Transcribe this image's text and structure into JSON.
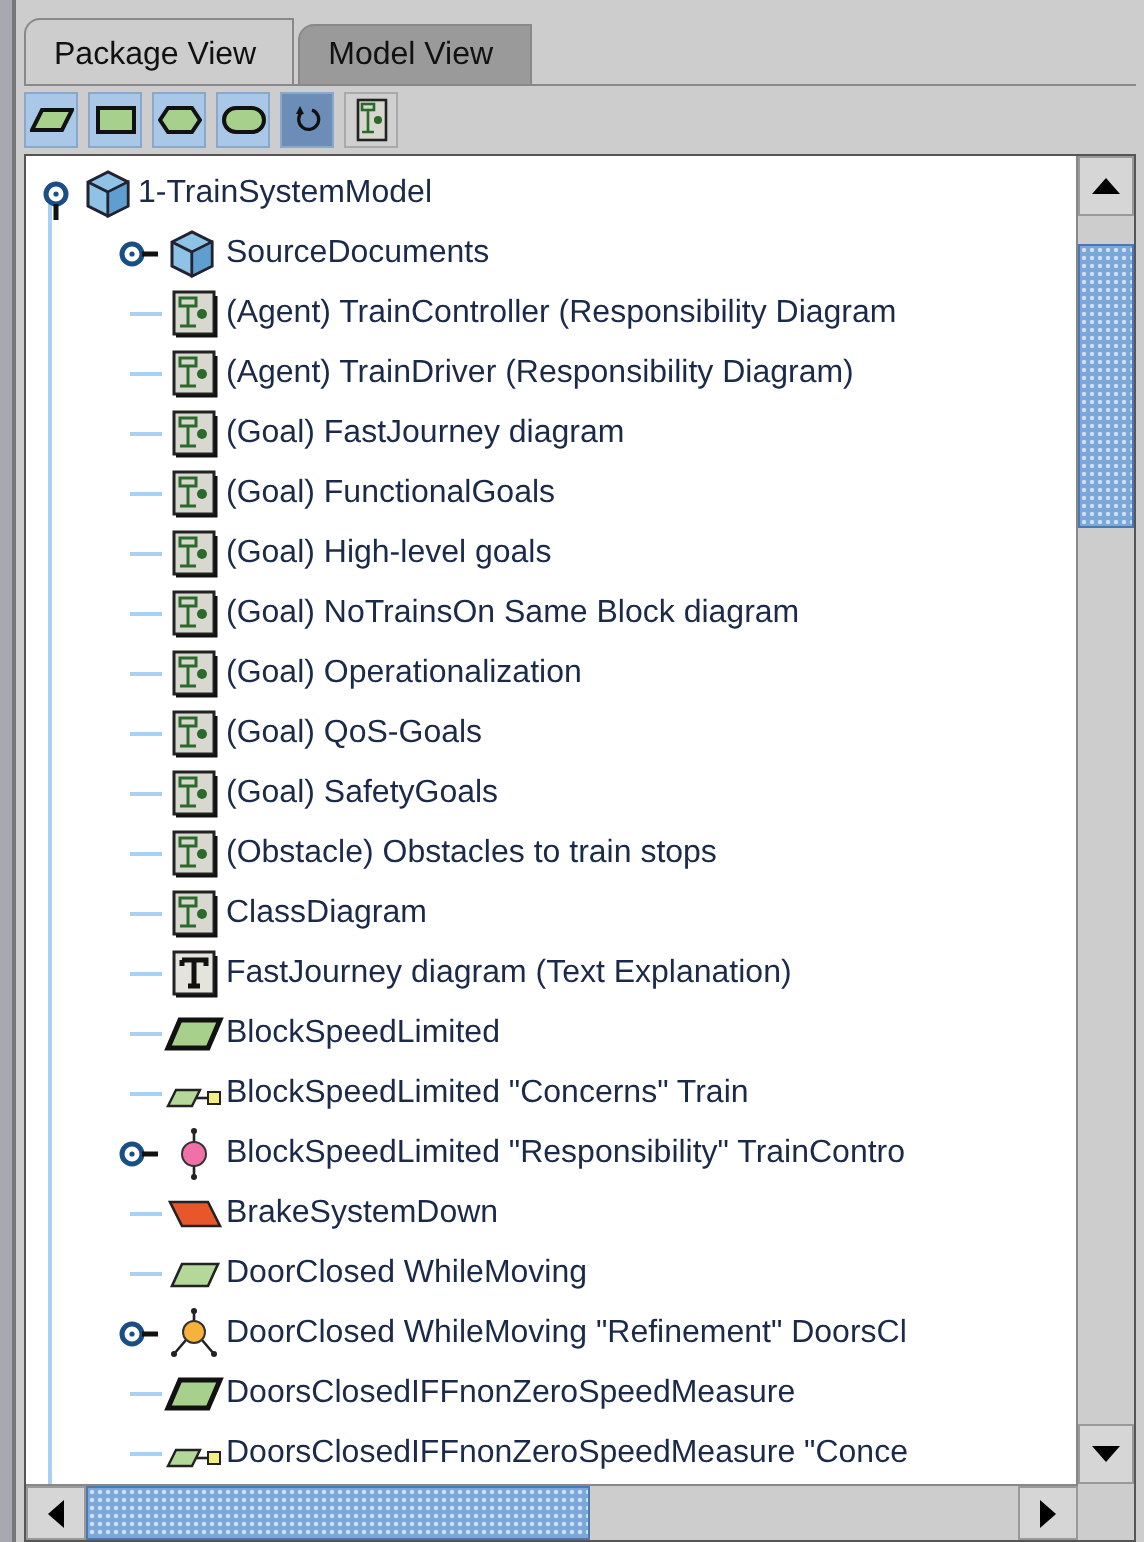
{
  "tabs": [
    {
      "label": "Package View",
      "selected": true
    },
    {
      "label": "Model View",
      "selected": false
    }
  ],
  "toolbar": [
    {
      "kind": "parallelogram",
      "selected": true
    },
    {
      "kind": "rectangle",
      "selected": true
    },
    {
      "kind": "hexagon",
      "selected": true
    },
    {
      "kind": "rounded",
      "selected": true
    },
    {
      "kind": "cycle",
      "selected": true
    },
    {
      "kind": "diagram",
      "selected": false
    }
  ],
  "tree": {
    "label": "1-TrainSystemModel",
    "kind": "package",
    "expanded": true,
    "children": [
      {
        "label": "SourceDocuments",
        "kind": "package",
        "expanded": false
      },
      {
        "label": "(Agent) TrainController (Responsibility Diagram",
        "kind": "diagram"
      },
      {
        "label": "(Agent) TrainDriver (Responsibility Diagram)",
        "kind": "diagram"
      },
      {
        "label": "(Goal) FastJourney diagram",
        "kind": "diagram"
      },
      {
        "label": "(Goal) FunctionalGoals",
        "kind": "diagram"
      },
      {
        "label": "(Goal) High-level goals",
        "kind": "diagram"
      },
      {
        "label": "(Goal) NoTrainsOn Same Block diagram",
        "kind": "diagram"
      },
      {
        "label": "(Goal) Operationalization",
        "kind": "diagram"
      },
      {
        "label": "(Goal) QoS-Goals",
        "kind": "diagram"
      },
      {
        "label": "(Goal) SafetyGoals",
        "kind": "diagram"
      },
      {
        "label": "(Obstacle) Obstacles to train stops",
        "kind": "diagram"
      },
      {
        "label": "ClassDiagram",
        "kind": "diagram"
      },
      {
        "label": "FastJourney diagram (Text Explanation)",
        "kind": "text"
      },
      {
        "label": "BlockSpeedLimited",
        "kind": "goal"
      },
      {
        "label": "BlockSpeedLimited \"Concerns\" Train",
        "kind": "concern"
      },
      {
        "label": "BlockSpeedLimited \"Responsibility\" TrainContro",
        "kind": "responsibility",
        "expanded": false
      },
      {
        "label": "BrakeSystemDown",
        "kind": "obstacle"
      },
      {
        "label": "DoorClosed WhileMoving",
        "kind": "softgoal"
      },
      {
        "label": "DoorClosed WhileMoving \"Refinement\" DoorsCl",
        "kind": "refinement",
        "expanded": false
      },
      {
        "label": "DoorsClosedIFFnonZeroSpeedMeasure",
        "kind": "goal"
      },
      {
        "label": "DoorsClosedIFFnonZeroSpeedMeasure \"Conce",
        "kind": "concern"
      }
    ]
  }
}
